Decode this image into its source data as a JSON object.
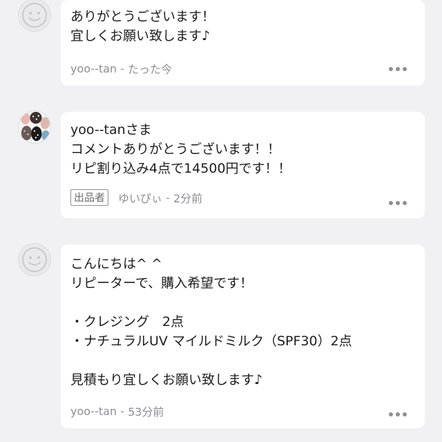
{
  "comments": [
    {
      "text": "ありがとうございます！\n宜しくお願い致します♪",
      "author": "yoo--tan",
      "time": "たった今",
      "avatar": "default-face-icon"
    },
    {
      "text": "yoo--tanさま\nコメントありがとうございます！！\nリピ割り込み4点で14500円です！！",
      "badge": "出品者",
      "author": "ゆいぴぃ",
      "time": "2分前",
      "avatar": "seller-photo"
    },
    {
      "text": "こんにちは^ ^\nリピーターで、購入希望です！\n\n・クレジング　2点\n・ナチュラルUV マイルドミルク（SPF30）2点\n\n見積もり宜しくお願い致します♪",
      "author": "yoo--tan",
      "time": "53分前",
      "avatar": "default-face-icon"
    }
  ],
  "separator": " - "
}
